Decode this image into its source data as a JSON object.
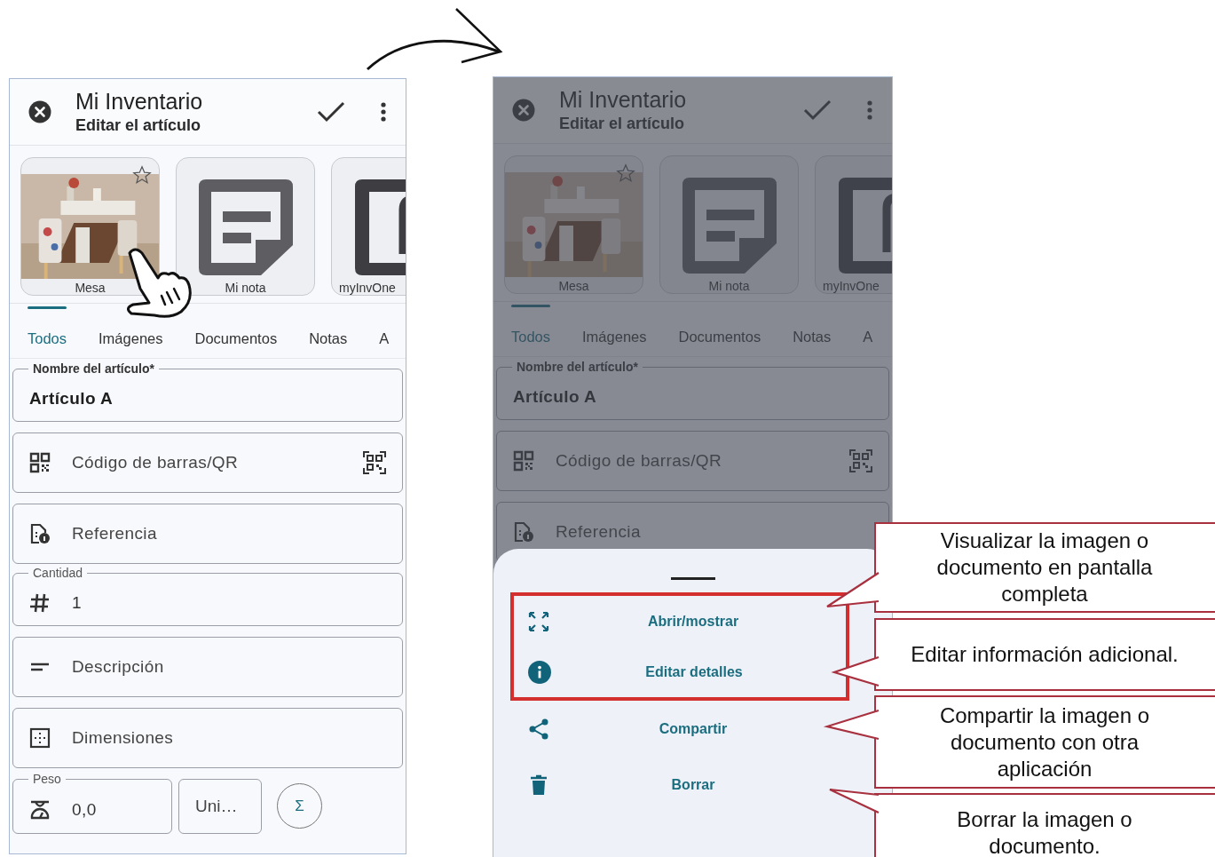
{
  "screens": [
    {
      "kind": "normal",
      "title": "Mi Inventario",
      "subtitle": "Editar el artículo",
      "attachments": [
        {
          "label": "Mesa",
          "starred": false
        },
        {
          "kind": "note",
          "label": "Mi nota"
        },
        {
          "kind": "file",
          "label": "myInvOne"
        }
      ],
      "tabs": [
        {
          "label": "Todos",
          "selected": true
        },
        {
          "label": "Imágenes",
          "selected": false
        },
        {
          "label": "Documentos",
          "selected": false
        },
        {
          "label": "Notas",
          "selected": false
        },
        {
          "label": "A",
          "selected": false
        }
      ],
      "fields": [
        {
          "kind": "name",
          "label": "Nombre del artículo*",
          "value": "Artículo A"
        },
        {
          "kind": "barcode",
          "placeholder": "Código de barras/QR"
        },
        {
          "kind": "reference",
          "placeholder": "Referencia"
        },
        {
          "kind": "quantity",
          "label": "Cantidad",
          "value": "1"
        },
        {
          "kind": "description",
          "placeholder": "Descripción"
        },
        {
          "kind": "dimensions",
          "placeholder": "Dimensiones"
        },
        {
          "kind": "weight",
          "label": "Peso",
          "value": "0,0",
          "unit": "Uni…",
          "button": "Σ"
        }
      ]
    },
    {
      "kind": "dimmed",
      "title": "Mi Inventario",
      "subtitle": "Editar el artículo",
      "attachments": [
        {
          "label": "Mesa",
          "starred": false
        },
        {
          "kind": "note",
          "label": "Mi nota"
        },
        {
          "kind": "file",
          "label": "myInvOne"
        }
      ],
      "tabs": [
        {
          "label": "Todos",
          "selected": true
        },
        {
          "label": "Imágenes",
          "selected": false
        },
        {
          "label": "Documentos",
          "selected": false
        },
        {
          "label": "Notas",
          "selected": false
        },
        {
          "label": "A",
          "selected": false
        }
      ],
      "fields": [
        {
          "kind": "name",
          "label": "Nombre del artículo*",
          "value": "Artículo A"
        },
        {
          "kind": "barcode",
          "placeholder": "Código de barras/QR"
        },
        {
          "kind": "reference",
          "placeholder": "Referencia"
        }
      ],
      "sheet": {
        "items": [
          {
            "kind": "open",
            "label": "Abrir/mostrar",
            "highlighted": true
          },
          {
            "kind": "details",
            "label": "Editar detalles",
            "highlighted": true
          },
          {
            "kind": "share",
            "label": "Compartir",
            "highlighted": false
          },
          {
            "kind": "delete",
            "label": "Borrar",
            "highlighted": false
          }
        ]
      }
    }
  ],
  "callouts": [
    {
      "text": "Visualizar la imagen o\ndocumento en pantalla\ncompleta"
    },
    {
      "text": "Editar información adicional."
    },
    {
      "text": "Compartir la imagen o\ndocumento con otra\naplicación"
    },
    {
      "text": "Borrar la imagen o\ndocumento."
    }
  ]
}
